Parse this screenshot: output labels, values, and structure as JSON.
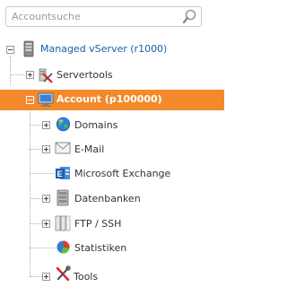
{
  "search": {
    "placeholder": "Accountsuche",
    "icon": "magnifier-icon"
  },
  "tree": {
    "root": {
      "label": "Managed vServer (r1000)",
      "icon": "server-icon",
      "expanded": true
    },
    "servertools": {
      "label": "Servertools",
      "icon": "server-tools-icon",
      "expanded": false
    },
    "account": {
      "label": "Account (p100000)",
      "icon": "monitor-icon",
      "expanded": true,
      "selected": true
    },
    "children": [
      {
        "key": "domains",
        "label": "Domains",
        "icon": "globe-icon",
        "expandable": true
      },
      {
        "key": "email",
        "label": "E-Mail",
        "icon": "envelope-icon",
        "expandable": true
      },
      {
        "key": "exchange",
        "label": "Microsoft Exchange",
        "icon": "exchange-icon",
        "expandable": false
      },
      {
        "key": "datenbanken",
        "label": "Datenbanken",
        "icon": "database-icon",
        "expandable": true
      },
      {
        "key": "ftp",
        "label": "FTP / SSH",
        "icon": "ftp-icon",
        "expandable": true
      },
      {
        "key": "statistiken",
        "label": "Statistiken",
        "icon": "pie-chart-icon",
        "expandable": false
      },
      {
        "key": "tools",
        "label": "Tools",
        "icon": "tools-icon",
        "expandable": true
      }
    ]
  },
  "colors": {
    "selected": "#f28a2d",
    "root_text": "#1a5fa8",
    "text": "#333333"
  }
}
